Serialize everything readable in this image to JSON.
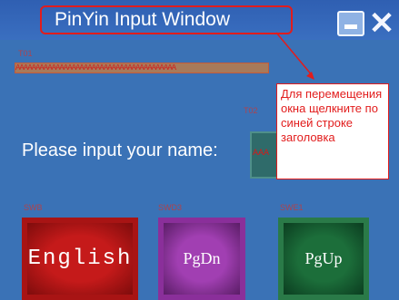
{
  "window": {
    "title": "PinYin Input Window",
    "minimize_icon": "minimize-icon",
    "close_glyph": "✕"
  },
  "labels": {
    "t1": "T01",
    "t2": "T02",
    "swb": "SWB",
    "swd": "SWD3",
    "swe": "SWE1"
  },
  "input_strip": {
    "text": "AAAAAAAAAAAAAAAAAAAAAAAAAAAAAAAAAAAAAAAA"
  },
  "prompt": {
    "label": "Please input your name:"
  },
  "name_field": {
    "value": "AAA"
  },
  "callout": {
    "text": "Для перемещения окна щелкните по синей строке заголовка"
  },
  "buttons": {
    "english": "English",
    "pgdn": "PgDn",
    "pgup": "PgUp"
  },
  "colors": {
    "background": "#3a72b6",
    "annotation": "#e21c1c"
  }
}
